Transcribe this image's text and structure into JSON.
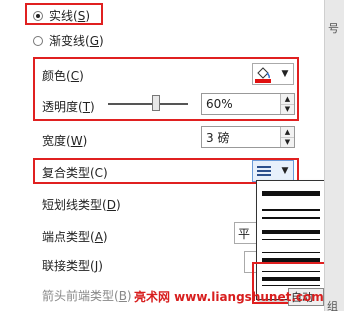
{
  "line_type": {
    "solid_label": "实线(",
    "solid_key": "S",
    "gradient_label": "渐变线(",
    "gradient_key": "G",
    "close_paren": ")"
  },
  "fields": {
    "color_label": "颜色(",
    "color_key": "C",
    "transparency_label": "透明度(",
    "transparency_key": "T",
    "transparency_value": "60%",
    "width_label": "宽度(",
    "width_key": "W",
    "width_value": "3 磅",
    "compound_label": "复合类型(C)",
    "dash_label": "短划线类型(",
    "dash_key": "D",
    "cap_label": "端点类型(",
    "cap_key": "A",
    "cap_value": "平",
    "join_label": "联接类型(",
    "join_key": "J",
    "arrow_label": "箭头前端类型(",
    "arrow_key": "B",
    "close_paren": ")"
  },
  "right_strip": {
    "top_text": "号",
    "bottom_text": "组"
  },
  "watermark": {
    "text": "亮术网 www.liangshunet.com",
    "partial_button": "自动"
  },
  "compound_options": [
    "single",
    "double",
    "thick-thin",
    "thin-thick",
    "triple"
  ],
  "colors": {
    "highlight_red": "#e02020",
    "watermark_red": "#d81e1e",
    "line_color_swatch": "#e01010"
  }
}
